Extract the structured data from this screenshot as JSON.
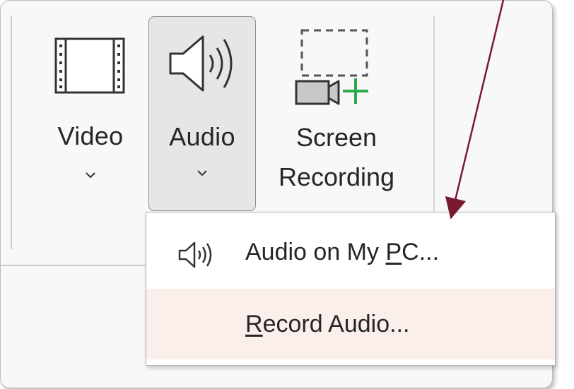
{
  "ribbon": {
    "video": {
      "label": "Video",
      "icon": "film-strip-icon"
    },
    "audio": {
      "label": "Audio",
      "icon": "speaker-icon"
    },
    "screen_recording": {
      "line1": "Screen",
      "line2": "Recording",
      "icon": "screen-record-icon"
    }
  },
  "menu": {
    "audio_on_pc": {
      "pre": "Audio on My ",
      "accel": "P",
      "post": "C...",
      "icon": "speaker-icon"
    },
    "record_audio": {
      "accel": "R",
      "post": "ecord Audio..."
    }
  },
  "colors": {
    "arrow": "#7a1a32",
    "record_highlight": "#faefeb",
    "add_plus": "#2eaa4a",
    "audio_selected_bg": "#e6e6e6"
  }
}
